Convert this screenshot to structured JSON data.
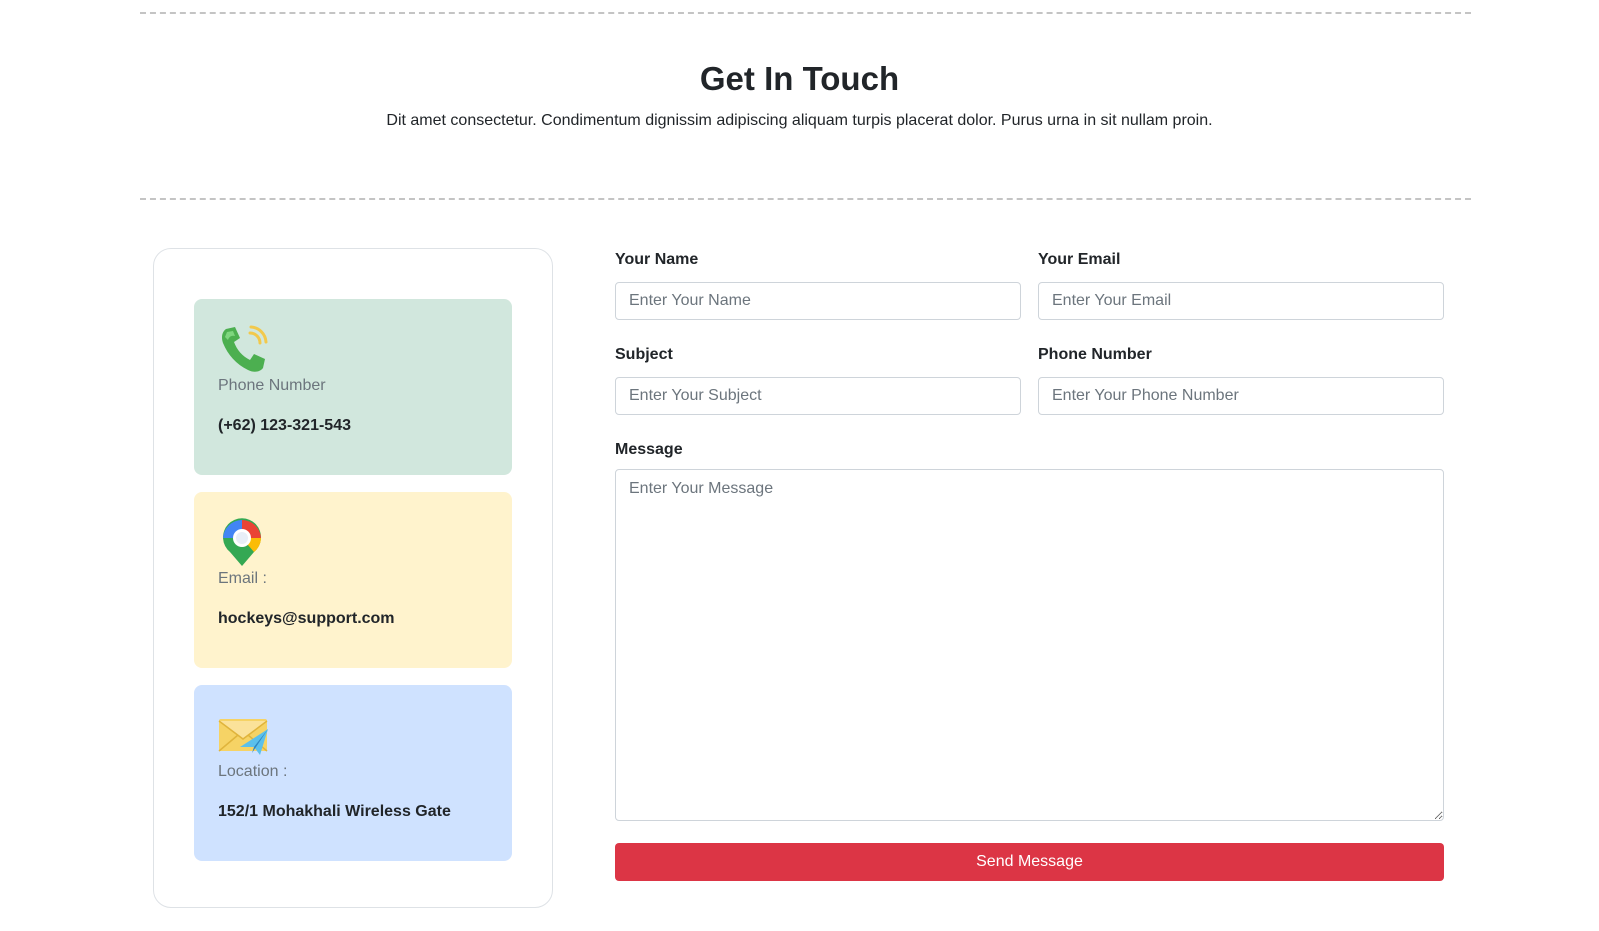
{
  "header": {
    "title": "Get In Touch",
    "subtitle": "Dit amet consectetur. Condimentum dignissim adipiscing aliquam turpis placerat dolor. Purus urna in sit nullam proin."
  },
  "contact_cards": [
    {
      "icon": "phone-icon",
      "label": "Phone Number",
      "value": "(+62) 123-321-543",
      "color": "#d1e7dd"
    },
    {
      "icon": "map-pin-icon",
      "label": "Email :",
      "value": "hockeys@support.com",
      "color": "#fff3cd"
    },
    {
      "icon": "envelope-icon",
      "label": "Location :",
      "value": "152/1 Mohakhali Wireless Gate",
      "color": "#cfe2ff"
    }
  ],
  "form": {
    "name": {
      "label": "Your Name",
      "placeholder": "Enter Your Name",
      "value": ""
    },
    "email": {
      "label": "Your Email",
      "placeholder": "Enter Your Email",
      "value": ""
    },
    "subject": {
      "label": "Subject",
      "placeholder": "Enter Your Subject",
      "value": ""
    },
    "phone": {
      "label": "Phone Number",
      "placeholder": "Enter Your Phone Number",
      "value": ""
    },
    "message": {
      "label": "Message",
      "placeholder": "Enter Your Message",
      "value": ""
    },
    "submit_label": "Send Message"
  },
  "colors": {
    "accent": "#dc3545",
    "divider": "#c4c4c4"
  }
}
